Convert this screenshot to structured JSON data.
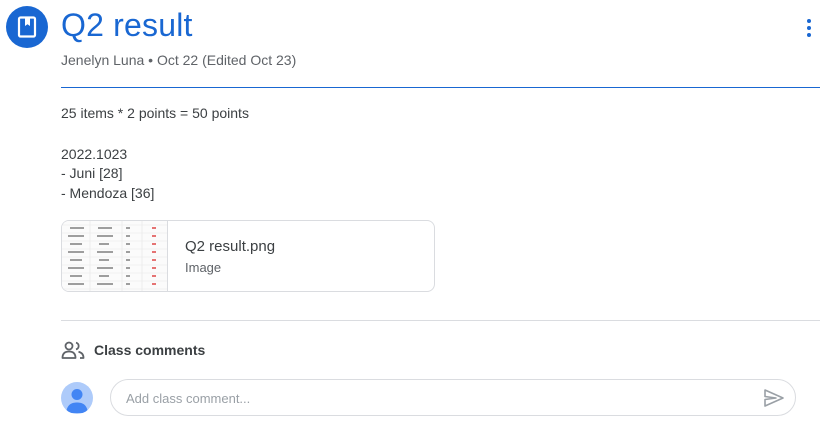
{
  "post": {
    "title": "Q2 result",
    "meta": "Jenelyn Luna • Oct 22 (Edited Oct 23)",
    "body_lines": [
      "25 items * 2 points = 50 points",
      "2022.1023",
      "- Juni [28]",
      "- Mendoza [36]"
    ]
  },
  "attachment": {
    "name": "Q2 result.png",
    "type": "Image"
  },
  "comments": {
    "label": "Class comments",
    "placeholder": "Add class comment..."
  },
  "icons": {
    "post": "assignment-book-icon",
    "more": "more-vert-icon",
    "comments": "people-icon",
    "avatar": "account-avatar-icon",
    "send": "send-icon"
  },
  "colors": {
    "accent": "#1967d2",
    "text": "#3c4043",
    "secondary_text": "#5f6368",
    "divider": "#dadce0",
    "avatar_bg": "#aecbfa",
    "avatar_fg": "#4285f4"
  }
}
